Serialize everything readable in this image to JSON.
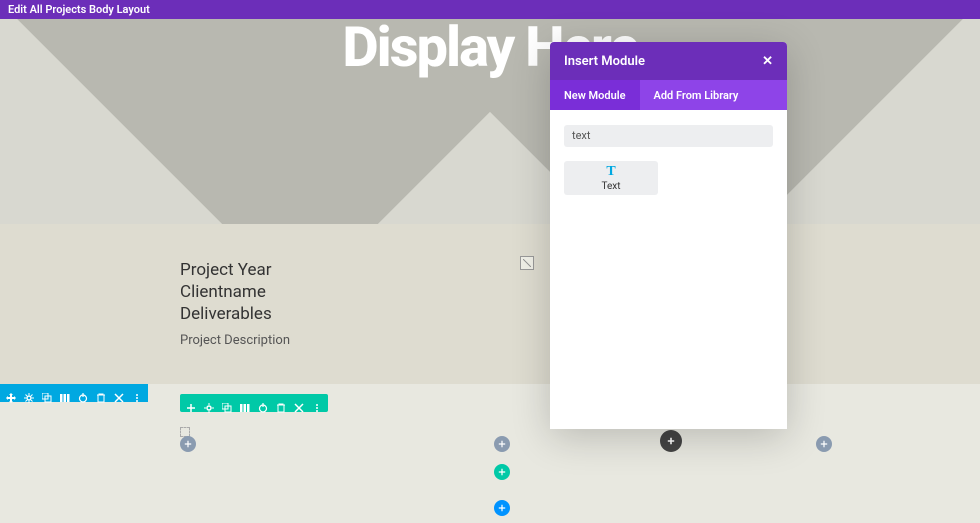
{
  "topbar": {
    "title": "Edit All Projects Body Layout"
  },
  "hero": {
    "title": "Display Here"
  },
  "project": {
    "year": "Project Year",
    "client": "Clientname",
    "deliverables": "Deliverables",
    "description": "Project Description"
  },
  "modal": {
    "title": "Insert Module",
    "tabs": {
      "new": "New Module",
      "library": "Add From Library"
    },
    "search_value": "text",
    "results": [
      {
        "icon_glyph": "T",
        "label": "Text"
      }
    ]
  },
  "section_toolbar": {
    "icons": [
      "move",
      "gear",
      "duplicate",
      "columns",
      "power",
      "trash",
      "close",
      "dotsv"
    ]
  },
  "row_toolbar": {
    "icons": [
      "plus",
      "gear",
      "duplicate",
      "columns",
      "power",
      "trash",
      "close",
      "dotsv"
    ]
  }
}
